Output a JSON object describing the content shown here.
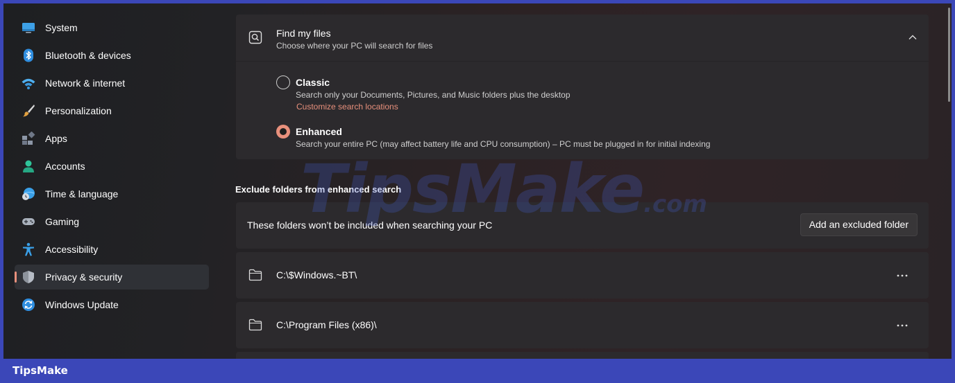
{
  "sidebar": {
    "items": [
      {
        "label": "System",
        "icon": "monitor-icon",
        "selected": false
      },
      {
        "label": "Bluetooth & devices",
        "icon": "bluetooth-icon",
        "selected": false
      },
      {
        "label": "Network & internet",
        "icon": "wifi-icon",
        "selected": false
      },
      {
        "label": "Personalization",
        "icon": "brush-icon",
        "selected": false
      },
      {
        "label": "Apps",
        "icon": "apps-icon",
        "selected": false
      },
      {
        "label": "Accounts",
        "icon": "person-icon",
        "selected": false
      },
      {
        "label": "Time & language",
        "icon": "globe-clock-icon",
        "selected": false
      },
      {
        "label": "Gaming",
        "icon": "gamepad-icon",
        "selected": false
      },
      {
        "label": "Accessibility",
        "icon": "accessibility-icon",
        "selected": false
      },
      {
        "label": "Privacy & security",
        "icon": "shield-icon",
        "selected": true
      },
      {
        "label": "Windows Update",
        "icon": "update-icon",
        "selected": false
      }
    ]
  },
  "find_my_files": {
    "title": "Find my files",
    "subtitle": "Choose where your PC will search for files",
    "expanded": true,
    "options": [
      {
        "title": "Classic",
        "description": "Search only your Documents, Pictures, and Music folders plus the desktop",
        "link": "Customize search locations",
        "selected": false
      },
      {
        "title": "Enhanced",
        "description": "Search your entire PC (may affect battery life and CPU consumption) – PC must be plugged in for initial indexing",
        "selected": true
      }
    ]
  },
  "exclude": {
    "section_title": "Exclude folders from enhanced search",
    "description": "These folders won’t be included when searching your PC",
    "add_button": "Add an excluded folder",
    "folders": [
      "C:\\$Windows.~BT\\",
      "C:\\Program Files (x86)\\"
    ]
  },
  "watermark": {
    "main": "TipsMake",
    "domain": ".com"
  },
  "footer": {
    "brand": "TipsMake"
  },
  "colors": {
    "accent": "#e8907c",
    "frame": "#3b47b8"
  }
}
